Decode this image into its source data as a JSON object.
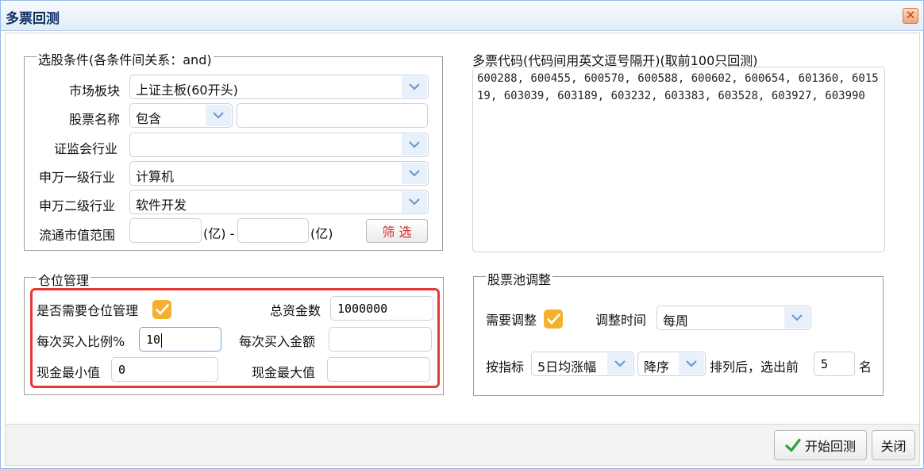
{
  "window": {
    "title": "多票回测",
    "close_glyph": "✕"
  },
  "selection": {
    "legend": "选股条件(各条件间关系：and)",
    "market_label": "市场板块",
    "market_value": "上证主板(60开头)",
    "name_label": "股票名称",
    "name_mode": "包含",
    "name_value": "",
    "csrc_label": "证监会行业",
    "csrc_value": "",
    "sw1_label": "申万一级行业",
    "sw1_value": "计算机",
    "sw2_label": "申万二级行业",
    "sw2_value": "软件开发",
    "cap_label": "流通市值范围",
    "cap_min": "",
    "cap_unit1": "(亿) -",
    "cap_max": "",
    "cap_unit2": "(亿)",
    "filter_button": "筛 选"
  },
  "codes": {
    "label": "多票代码(代码间用英文逗号隔开)(取前100只回测)",
    "value": "600288, 600455, 600570, 600588, 600602, 600654, 601360, 601519, 603039, 603189, 603232, 603383, 603528, 603927, 603990"
  },
  "position": {
    "legend": "仓位管理",
    "need_label": "是否需要仓位管理",
    "need_checked": true,
    "capital_label": "总资金数",
    "capital_value": "1000000",
    "ratio_label": "每次买入比例%",
    "ratio_value": "10",
    "amount_label": "每次买入金额",
    "amount_value": "",
    "cash_min_label": "现金最小值",
    "cash_min_value": "0",
    "cash_max_label": "现金最大值",
    "cash_max_value": ""
  },
  "pool": {
    "legend": "股票池调整",
    "adjust_label": "需要调整",
    "adjust_checked": true,
    "time_label": "调整时间",
    "time_value": "每周",
    "by_label": "按指标",
    "indicator_value": "5日均涨幅",
    "order_value": "降序",
    "rank_label": "排列后，选出前",
    "top_n": "5",
    "unit": "名"
  },
  "footer": {
    "start_label": "开始回测",
    "close_label": "关闭"
  },
  "colors": {
    "accent": "#f5b12e",
    "highlight": "#e53935",
    "filter_text": "#d32f2f",
    "start_icon": "#2e9e3a"
  }
}
